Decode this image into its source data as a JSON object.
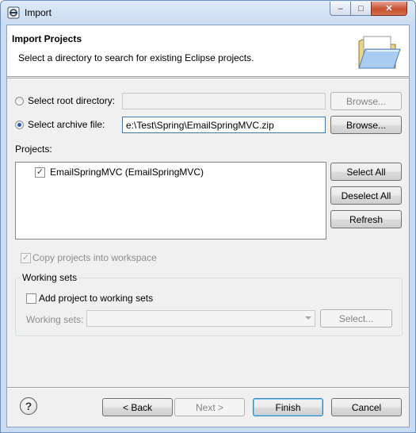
{
  "window": {
    "title": "Import",
    "minimize_glyph": "–",
    "maximize_glyph": "□",
    "close_glyph": "✕"
  },
  "header": {
    "title": "Import Projects",
    "description": "Select a directory to search for existing Eclipse projects."
  },
  "source": {
    "root_directory_label": "Select root directory:",
    "root_directory_value": "",
    "root_browse_label": "Browse...",
    "archive_file_label": "Select archive file:",
    "archive_file_value": "e:\\Test\\Spring\\EmailSpringMVC.zip",
    "archive_browse_label": "Browse..."
  },
  "projects": {
    "label": "Projects:",
    "items": [
      {
        "label": "EmailSpringMVC (EmailSpringMVC)",
        "checked": true
      }
    ],
    "select_all_label": "Select All",
    "deselect_all_label": "Deselect All",
    "refresh_label": "Refresh"
  },
  "options": {
    "copy_into_workspace_label": "Copy projects into workspace",
    "copy_into_workspace_checked": true
  },
  "working_sets": {
    "group_title": "Working sets",
    "add_label": "Add project to working sets",
    "add_checked": false,
    "sets_label": "Working sets:",
    "sets_value": "",
    "select_label": "Select..."
  },
  "footer": {
    "help_glyph": "?",
    "back_label": "< Back",
    "next_label": "Next >",
    "finish_label": "Finish",
    "cancel_label": "Cancel"
  },
  "colors": {
    "radio_selected": "#2d5aa8",
    "default_button_border": "#3c7fb1",
    "close_button": "#c7502f"
  }
}
